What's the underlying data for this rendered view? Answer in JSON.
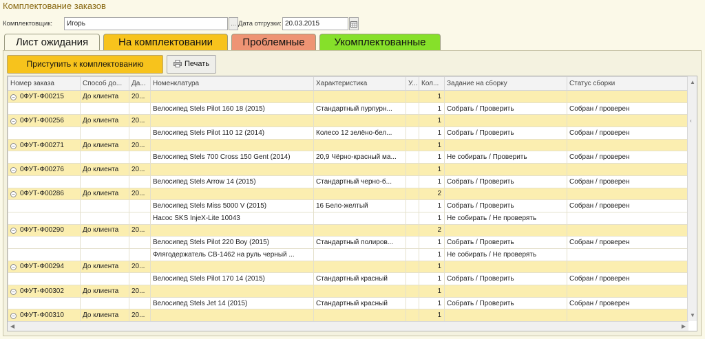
{
  "window": {
    "title": "Комплектование заказов"
  },
  "filters": {
    "picker_label": "Комплектовщик:",
    "picker_value": "Игорь",
    "picker_button": "...",
    "date_label": "Дата отгрузки:",
    "date_value": "20.03.2015"
  },
  "tabs": [
    {
      "label": "Лист ожидания",
      "color": "#fbf9e8"
    },
    {
      "label": "На комплектовании",
      "color": "#f7c31c"
    },
    {
      "label": "Проблемные",
      "color": "#ee9474"
    },
    {
      "label": "Укомплектованные",
      "color": "#86e02a"
    }
  ],
  "toolbar": {
    "start_label": "Приступить к комплектованию",
    "print_label": "Печать"
  },
  "colors": {
    "group_row": "#fbeeb0",
    "accent": "#f7c31c",
    "title": "#8a6a14"
  },
  "table": {
    "columns": [
      "Номер заказа",
      "Способ до...",
      "Да...",
      "Номенклатура",
      "Характеристика",
      "У...",
      "Кол...",
      "Задание на сборку",
      "Статус сборки"
    ],
    "rows": [
      {
        "type": "group",
        "order": "0ФУТ-Ф00215",
        "delivery": "До клиента",
        "date": "20...",
        "qty": "1"
      },
      {
        "type": "item",
        "nomenclature": "Велосипед Stels Pilot 160 18 (2015)",
        "characteristic": "Стандартный пурпурн...",
        "qty": "1",
        "task": "Собрать / Проверить",
        "status": "Собран / проверен"
      },
      {
        "type": "group",
        "order": "0ФУТ-Ф00256",
        "delivery": "До клиента",
        "date": "20...",
        "qty": "1"
      },
      {
        "type": "item",
        "nomenclature": "Велосипед Stels Pilot 110 12 (2014)",
        "characteristic": "Колесо 12 зелёно-бел...",
        "qty": "1",
        "task": "Собрать / Проверить",
        "status": "Собран / проверен"
      },
      {
        "type": "group",
        "order": "0ФУТ-Ф00271",
        "delivery": "До клиента",
        "date": "20...",
        "qty": "1"
      },
      {
        "type": "item",
        "nomenclature": "Велосипед Stels 700 Cross 150 Gent (2014)",
        "characteristic": "20,9 Чёрно-красный ма...",
        "qty": "1",
        "task": "Не собирать / Проверить",
        "status": "Собран / проверен"
      },
      {
        "type": "group",
        "order": "0ФУТ-Ф00276",
        "delivery": "До клиента",
        "date": "20...",
        "qty": "1"
      },
      {
        "type": "item",
        "nomenclature": "Велосипед Stels Arrow 14 (2015)",
        "characteristic": "Стандартный черно-б...",
        "qty": "1",
        "task": "Собрать / Проверить",
        "status": "Собран / проверен"
      },
      {
        "type": "group",
        "order": "0ФУТ-Ф00286",
        "delivery": "До клиента",
        "date": "20...",
        "qty": "2"
      },
      {
        "type": "item",
        "nomenclature": "Велосипед Stels Miss 5000 V (2015)",
        "characteristic": "16 Бело-желтый",
        "qty": "1",
        "task": "Собрать / Проверить",
        "status": "Собран / проверен"
      },
      {
        "type": "item",
        "nomenclature": "Насос SKS InjeX-Lite 10043",
        "characteristic": "",
        "qty": "1",
        "task": "Не собирать / Не проверять",
        "status": ""
      },
      {
        "type": "group",
        "order": "0ФУТ-Ф00290",
        "delivery": "До клиента",
        "date": "20...",
        "qty": "2"
      },
      {
        "type": "item",
        "nomenclature": "Велосипед Stels Pilot 220 Boy (2015)",
        "characteristic": "Стандартный полиров...",
        "qty": "1",
        "task": "Собрать / Проверить",
        "status": "Собран / проверен"
      },
      {
        "type": "item",
        "nomenclature": "Флягодержатель СВ-1462 на руль черный ...",
        "characteristic": "",
        "qty": "1",
        "task": "Не собирать / Не проверять",
        "status": ""
      },
      {
        "type": "group",
        "order": "0ФУТ-Ф00294",
        "delivery": "До клиента",
        "date": "20...",
        "qty": "1"
      },
      {
        "type": "item",
        "nomenclature": "Велосипед Stels Pilot 170 14 (2015)",
        "characteristic": "Стандартный красный",
        "qty": "1",
        "task": "Собрать / Проверить",
        "status": "Собран / проверен"
      },
      {
        "type": "group",
        "order": "0ФУТ-Ф00302",
        "delivery": "До клиента",
        "date": "20...",
        "qty": "1"
      },
      {
        "type": "item",
        "nomenclature": "Велосипед Stels Jet 14 (2015)",
        "characteristic": "Стандартный красный",
        "qty": "1",
        "task": "Собрать / Проверить",
        "status": "Собран / проверен"
      },
      {
        "type": "group",
        "order": "0ФУТ-Ф00310",
        "delivery": "До клиента",
        "date": "20...",
        "qty": "1"
      }
    ]
  }
}
